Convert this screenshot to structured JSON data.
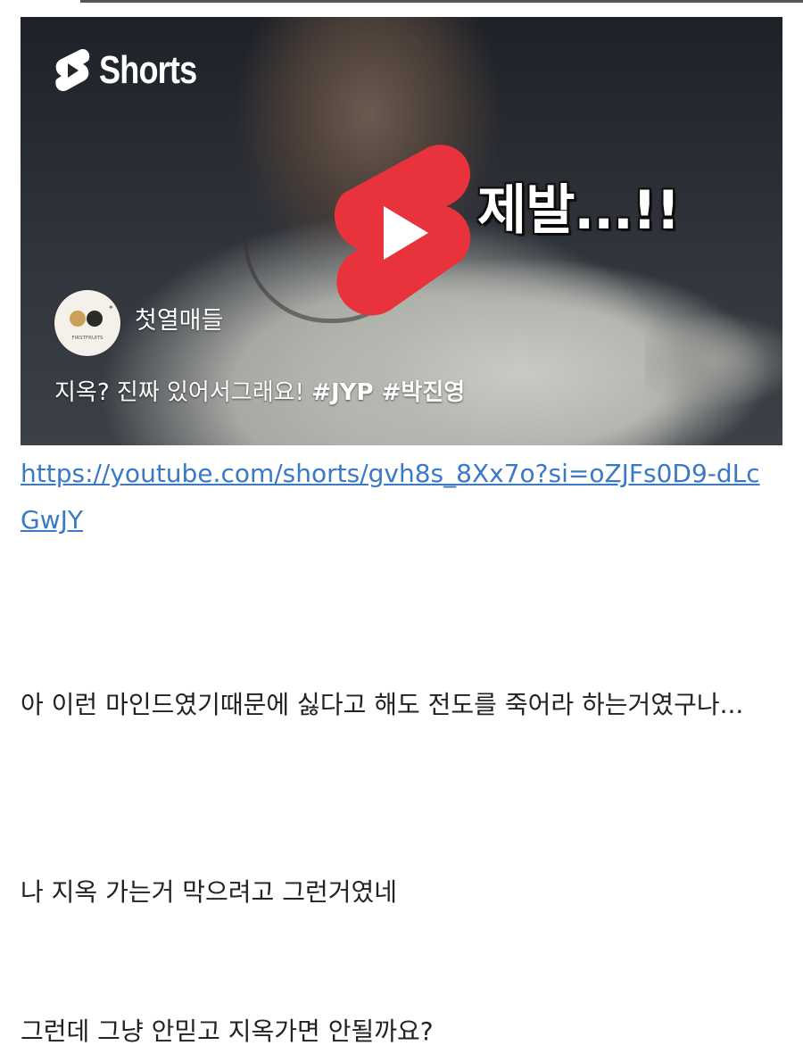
{
  "video": {
    "brand_label": "Shorts",
    "overlay_caption": "제발...!!",
    "channel_name": "첫열매들",
    "channel_logo_text": "FIRSTFRUITS",
    "title_text": "지옥? 진짜 있어서그래요! ",
    "title_tags": "#JYP #박진영",
    "play_icon": "youtube-shorts-play-icon",
    "accent_color": "#e8333c"
  },
  "link": {
    "text": "https://youtube.com/shorts/gvh8s_8Xx7o?si=oZJFs0D9-dLcGwJY",
    "color": "#3a79c6"
  },
  "paragraphs": [
    "아 이런 마인드였기때문에 싫다고 해도 전도를 죽어라 하는거였구나...",
    "나 지옥 가는거 막으려고 그런거였네",
    "그런데 그냥 안믿고 지옥가면 안될까요?"
  ]
}
